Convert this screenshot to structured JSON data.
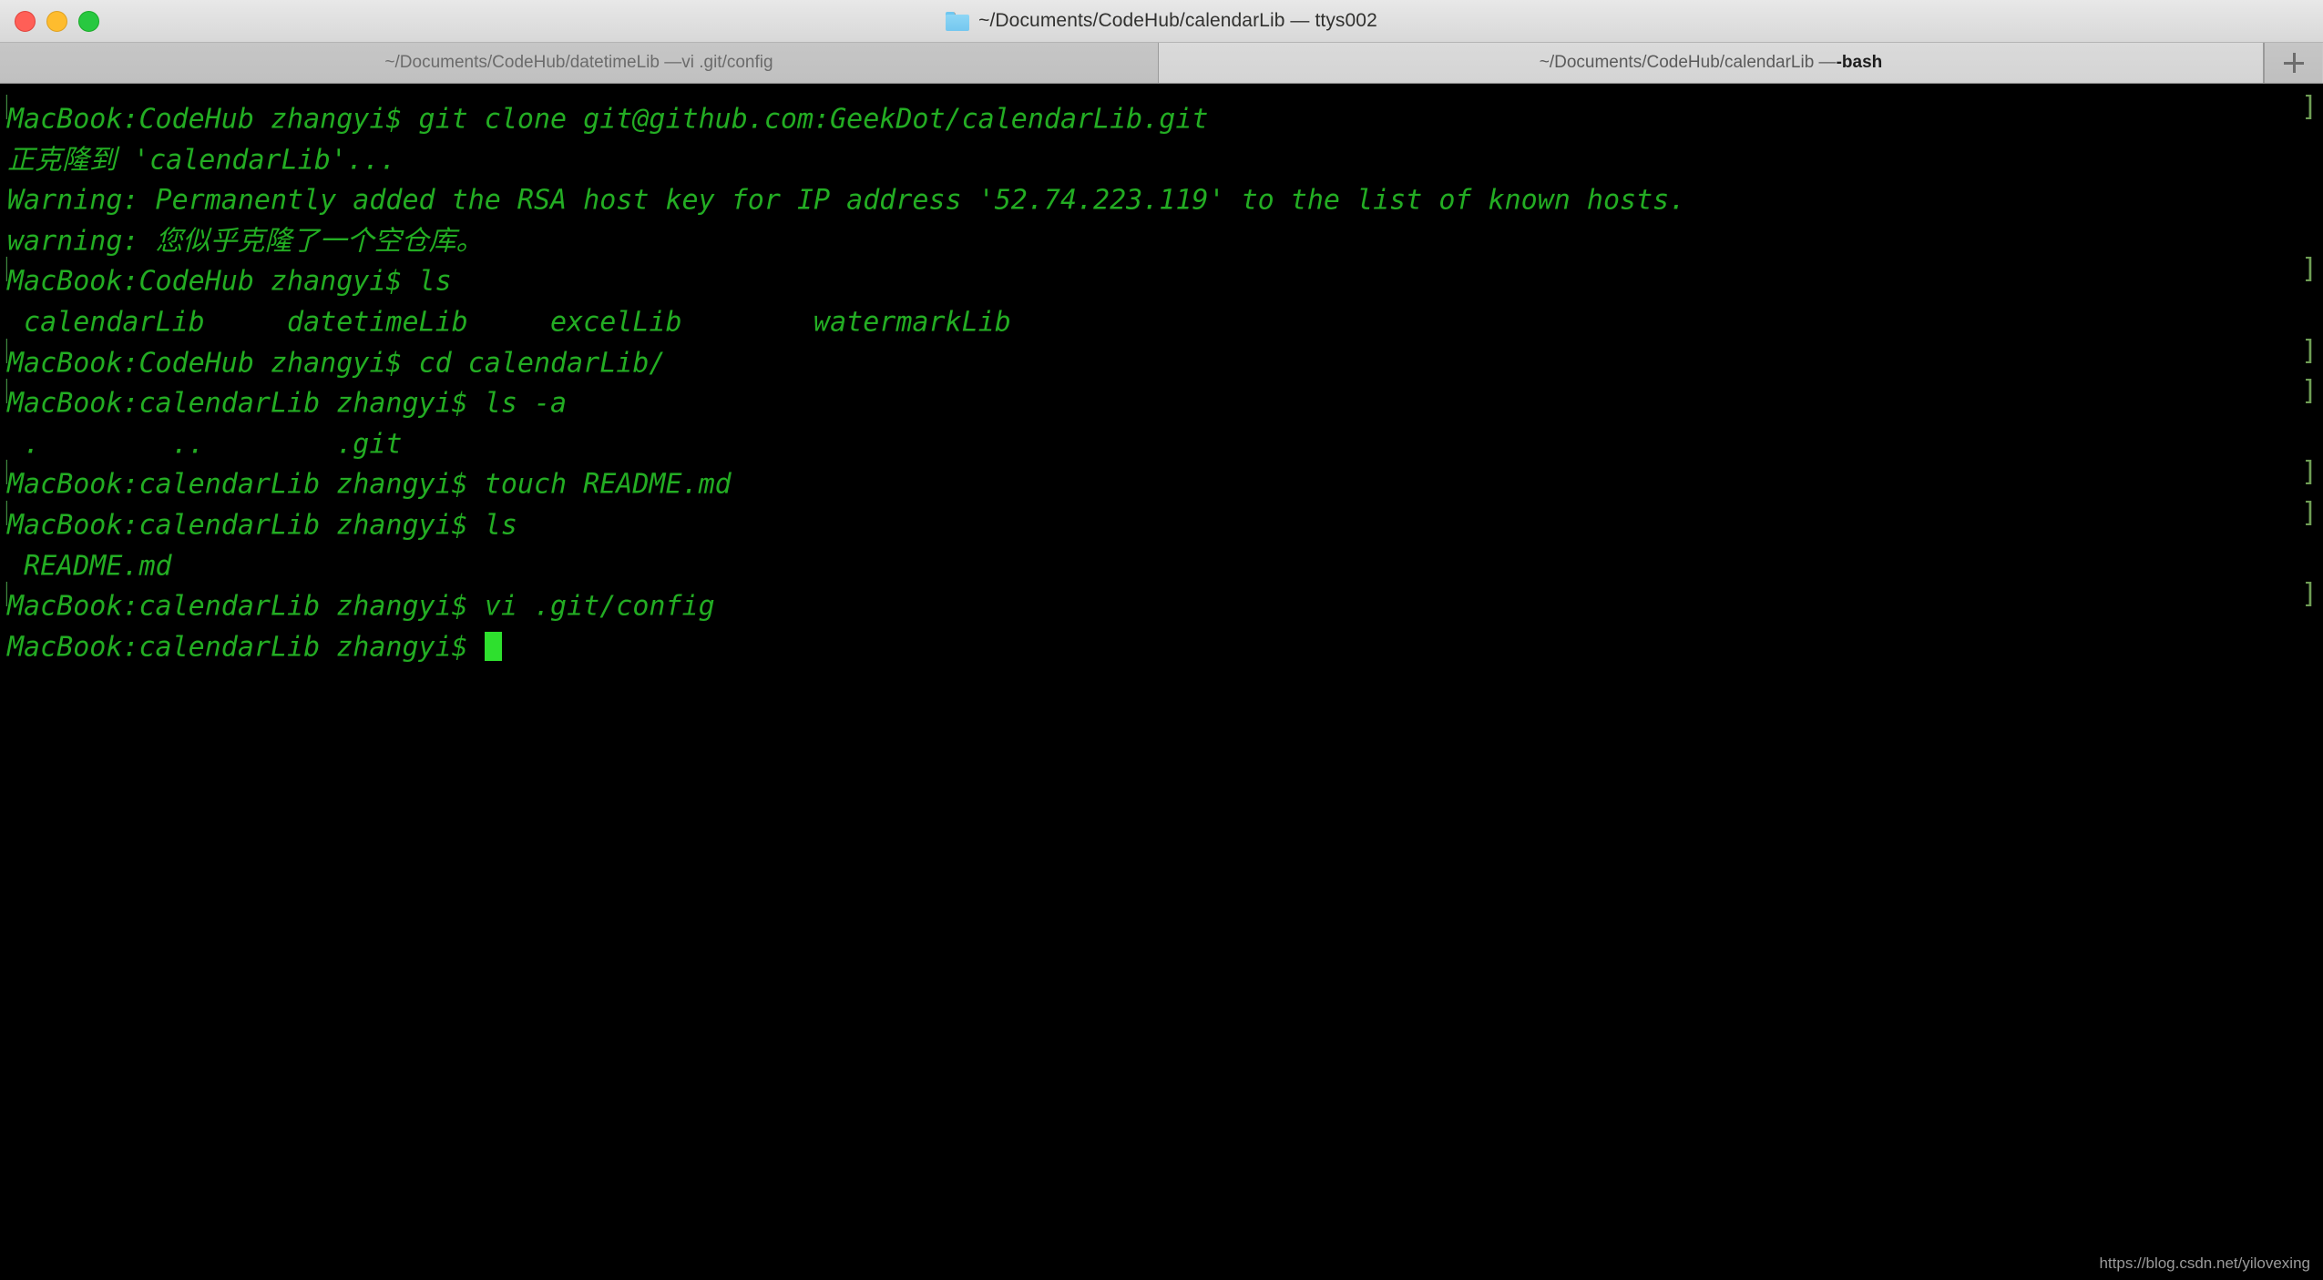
{
  "window": {
    "title": "~/Documents/CodeHub/calendarLib — ttys002",
    "folder_icon": "folder-icon",
    "traffic_lights": [
      {
        "name": "close",
        "color": "#ff5f57"
      },
      {
        "name": "minimize",
        "color": "#febc2e"
      },
      {
        "name": "maximize",
        "color": "#28c840"
      }
    ]
  },
  "tabbar": {
    "new_tab_label": "+",
    "tabs": [
      {
        "path": "~/Documents/CodeHub/datetimeLib — ",
        "process": "vi .git/config",
        "active": false
      },
      {
        "path": "~/Documents/CodeHub/calendarLib — ",
        "process": "-bash",
        "active": true
      }
    ]
  },
  "terminal": {
    "foreground_color": "#23ad23",
    "background_color": "#000000",
    "cursor_color": "#2ee02e",
    "lines": [
      {
        "lead": "[",
        "text": "MacBook:CodeHub zhangyi$ git clone git@github.com:GeekDot/calendarLib.git",
        "mark": "]"
      },
      {
        "lead": "",
        "text": "正克隆到 'calendarLib'...",
        "mark": ""
      },
      {
        "lead": "",
        "text": "Warning: Permanently added the RSA host key for IP address '52.74.223.119' to the list of known hosts.",
        "mark": ""
      },
      {
        "lead": "",
        "text": "warning: 您似乎克隆了一个空仓库。",
        "mark": ""
      },
      {
        "lead": "[",
        "text": "MacBook:CodeHub zhangyi$ ls",
        "mark": "]"
      },
      {
        "lead": "",
        "text": " calendarLib     datetimeLib     excelLib        watermarkLib",
        "mark": ""
      },
      {
        "lead": "[",
        "text": "MacBook:CodeHub zhangyi$ cd calendarLib/",
        "mark": "]"
      },
      {
        "lead": "[",
        "text": "MacBook:calendarLib zhangyi$ ls -a",
        "mark": "]"
      },
      {
        "lead": "",
        "text": " .        ..        .git",
        "mark": ""
      },
      {
        "lead": "[",
        "text": "MacBook:calendarLib zhangyi$ touch README.md",
        "mark": "]"
      },
      {
        "lead": "[",
        "text": "MacBook:calendarLib zhangyi$ ls",
        "mark": "]"
      },
      {
        "lead": "",
        "text": " README.md",
        "mark": ""
      },
      {
        "lead": "[",
        "text": "MacBook:calendarLib zhangyi$ vi .git/config",
        "mark": "]"
      },
      {
        "lead": "",
        "text": "MacBook:calendarLib zhangyi$ ",
        "mark": "",
        "cursor": true
      }
    ]
  },
  "watermark": {
    "text": "https://blog.csdn.net/yilovexing"
  }
}
